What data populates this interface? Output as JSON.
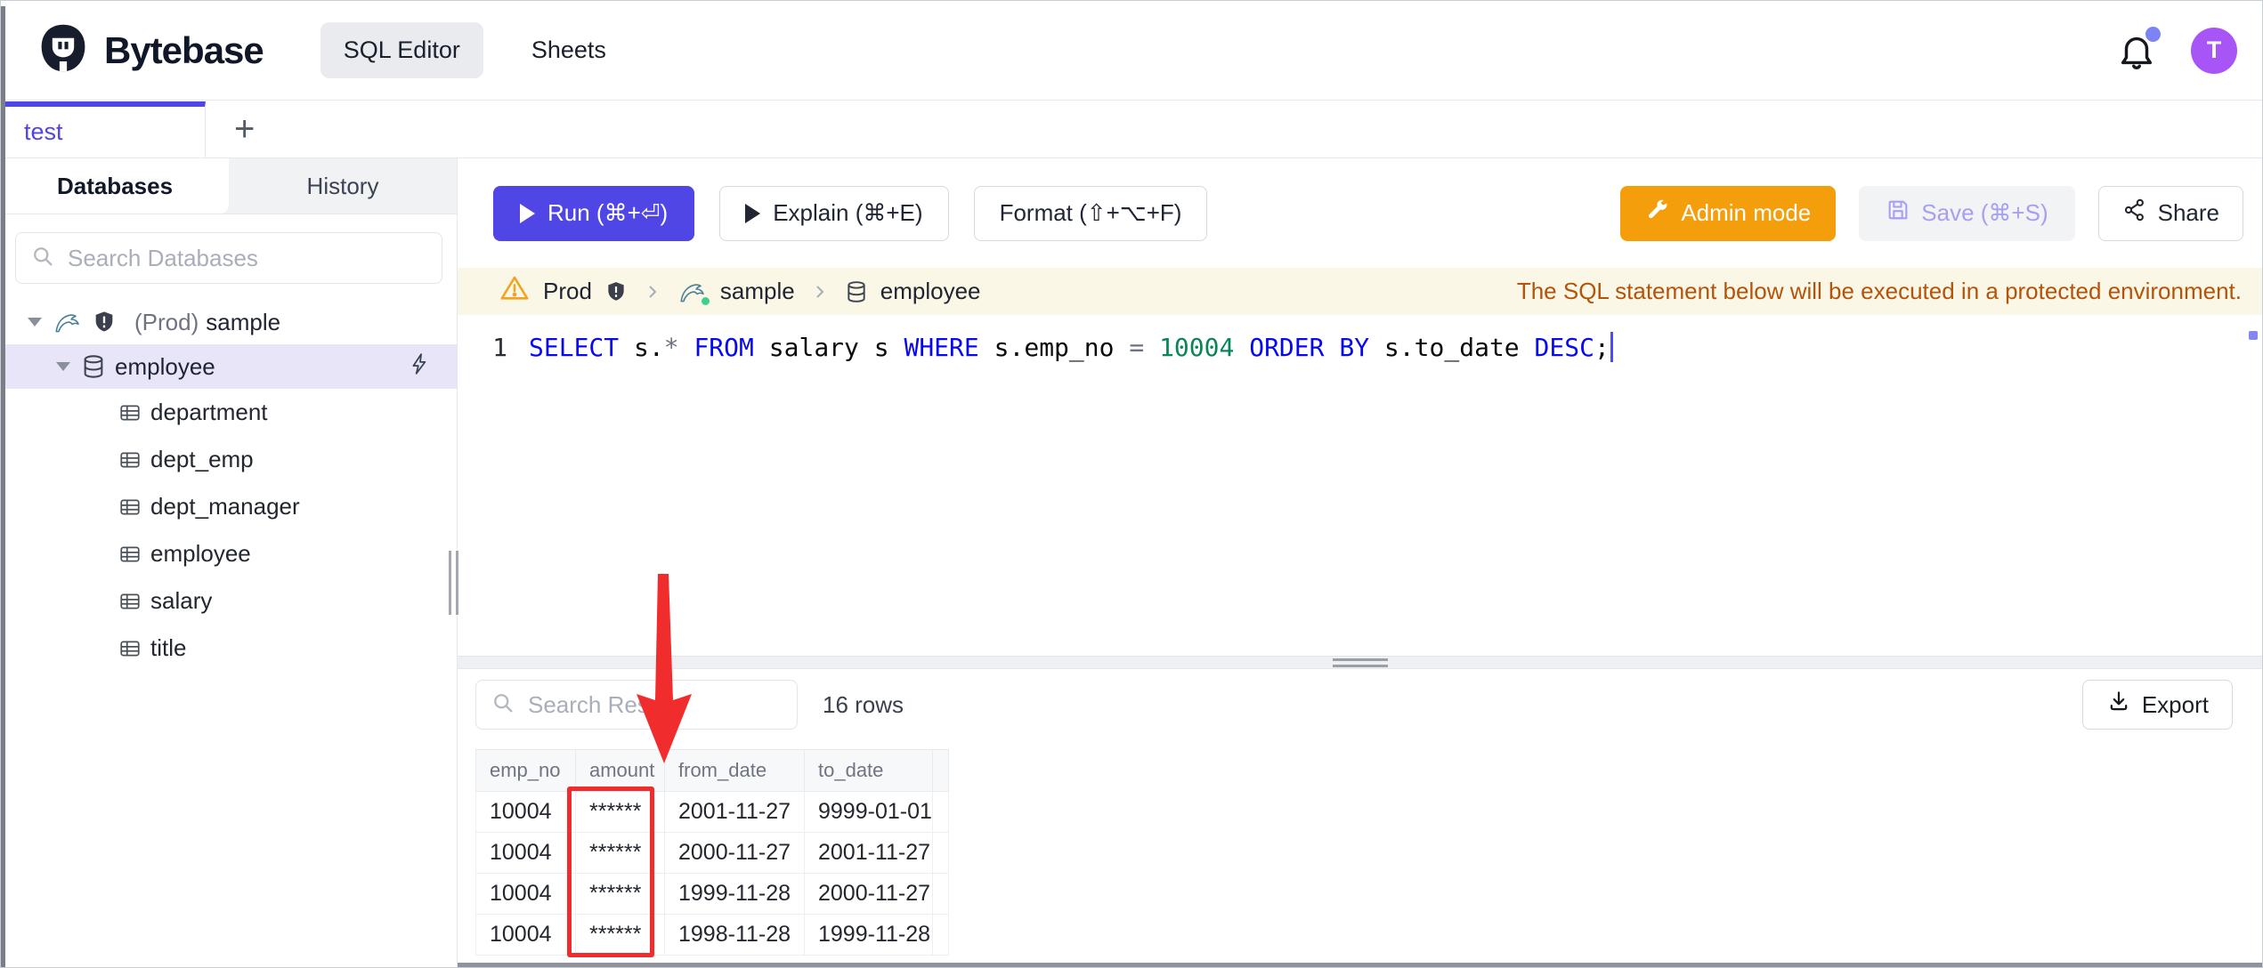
{
  "header": {
    "brand": "Bytebase",
    "nav": [
      {
        "label": "SQL Editor",
        "active": true
      },
      {
        "label": "Sheets",
        "active": false
      }
    ],
    "avatar_letter": "T"
  },
  "tab_bar": {
    "tabs": [
      {
        "label": "test",
        "active": true
      }
    ],
    "add_button": "+"
  },
  "sidebar": {
    "tabs": [
      {
        "label": "Databases",
        "active": true
      },
      {
        "label": "History",
        "active": false
      }
    ],
    "search_placeholder": "Search Databases",
    "tree": {
      "environment_label": "(Prod)",
      "database_name": "sample",
      "schema_name": "employee",
      "tables": [
        "department",
        "dept_emp",
        "dept_manager",
        "employee",
        "salary",
        "title"
      ]
    }
  },
  "toolbar": {
    "run_label": "Run (⌘+⏎)",
    "explain_label": "Explain (⌘+E)",
    "format_label": "Format (⇧+⌥+F)",
    "admin_mode_label": "Admin mode",
    "save_label": "Save (⌘+S)",
    "share_label": "Share"
  },
  "context_bar": {
    "environment": "Prod",
    "database": "sample",
    "table": "employee",
    "warning_message": "The SQL statement below will be executed in a protected environment."
  },
  "editor": {
    "line_number": "1",
    "sql_text": "SELECT s.* FROM salary s WHERE s.emp_no = 10004 ORDER BY s.to_date DESC;",
    "tokens": [
      {
        "text": "SELECT",
        "type": "keyword"
      },
      {
        "text": " s.",
        "type": "plain"
      },
      {
        "text": "*",
        "type": "operator"
      },
      {
        "text": " ",
        "type": "plain"
      },
      {
        "text": "FROM",
        "type": "keyword"
      },
      {
        "text": " salary s ",
        "type": "plain"
      },
      {
        "text": "WHERE",
        "type": "keyword"
      },
      {
        "text": " s.emp_no ",
        "type": "plain"
      },
      {
        "text": "=",
        "type": "operator"
      },
      {
        "text": " ",
        "type": "plain"
      },
      {
        "text": "10004",
        "type": "number"
      },
      {
        "text": " ",
        "type": "plain"
      },
      {
        "text": "ORDER BY",
        "type": "keyword"
      },
      {
        "text": " s.to_date ",
        "type": "plain"
      },
      {
        "text": "DESC",
        "type": "keyword"
      },
      {
        "text": ";",
        "type": "plain"
      }
    ]
  },
  "results": {
    "search_placeholder": "Search Results",
    "row_count_label": "16 rows",
    "export_label": "Export",
    "table": {
      "columns": [
        "emp_no",
        "amount",
        "from_date",
        "to_date"
      ],
      "rows": [
        [
          "10004",
          "******",
          "2001-11-27",
          "9999-01-01"
        ],
        [
          "10004",
          "******",
          "2000-11-27",
          "2001-11-27"
        ],
        [
          "10004",
          "******",
          "1999-11-28",
          "2000-11-27"
        ],
        [
          "10004",
          "******",
          "1998-11-28",
          "1999-11-28"
        ]
      ]
    }
  },
  "annotations": {
    "highlighted_column": "amount",
    "highlight_color": "#f12c2c",
    "shapes": [
      "red-arrow-down",
      "red-rectangle-around-amount-column"
    ]
  },
  "icons": {
    "bytebase-logo": "dark mascot face",
    "bell-icon": "notification bell outline",
    "search-icon": "magnifier",
    "mysql-icon": "teal dolphin",
    "shield-icon": "dark shield with exclamation",
    "database-icon": "cylinder stack",
    "table-icon": "grid",
    "bolt-icon": "lightning outline",
    "warning-icon": "amber triangle with exclamation",
    "chevron-right-icon": "thin right angle",
    "wrench-icon": "white wrench",
    "save-icon": "floppy disk outline",
    "share-icon": "three connected nodes",
    "download-icon": "arrow into tray"
  },
  "colors": {
    "accent_indigo": "#4f46e5",
    "admin_orange": "#f59e0b",
    "warning_text": "#b45309",
    "warning_bg": "#fbf7e6",
    "avatar_purple": "#a855f7",
    "keyword_blue": "#0808f0",
    "number_green": "#098658",
    "selection_lavender": "#e8e5f8",
    "annotation_red": "#f12c2c"
  }
}
